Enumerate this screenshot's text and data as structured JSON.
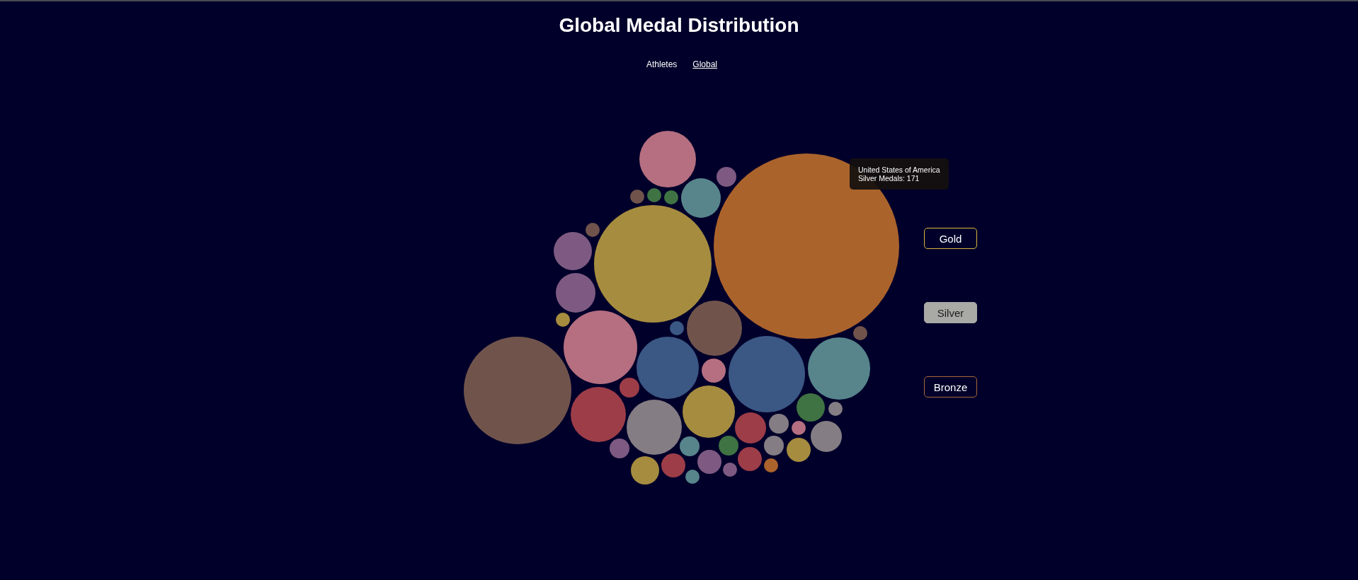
{
  "title": "Global Medal Distribution",
  "nav": [
    {
      "label": "Athletes",
      "selected": false
    },
    {
      "label": "Global",
      "selected": true
    }
  ],
  "tooltip": {
    "lines": [
      "United States of America",
      "Silver Medals: 171"
    ]
  },
  "medal_buttons": [
    {
      "label": "Gold",
      "selected": false,
      "color": "#d9b53a"
    },
    {
      "label": "Silver",
      "selected": true,
      "color": "#a9a9a5"
    },
    {
      "label": "Bronze",
      "selected": false,
      "color": "#a8683a"
    }
  ]
}
